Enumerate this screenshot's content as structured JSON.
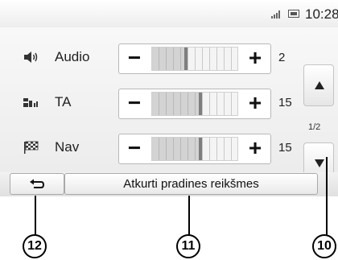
{
  "status": {
    "time": "10:28",
    "icons": [
      "signal-icon",
      "phone-icon"
    ]
  },
  "rows": [
    {
      "label": "Audio",
      "icon": "speaker-icon",
      "value": "2",
      "level": 0.38
    },
    {
      "label": "TA",
      "icon": "traffic-announcement-icon",
      "value": "15",
      "level": 0.55
    },
    {
      "label": "Nav",
      "icon": "checkered-flag-icon",
      "value": "15",
      "level": 0.55
    }
  ],
  "controls": {
    "minus": "−",
    "plus": "+"
  },
  "pager": {
    "page": "1/2"
  },
  "bottom": {
    "back_icon": "back-arrow-icon",
    "reset_label": "Atkurti pradines reikšmes"
  },
  "callouts": {
    "back": "12",
    "reset": "11",
    "pager": "10"
  }
}
